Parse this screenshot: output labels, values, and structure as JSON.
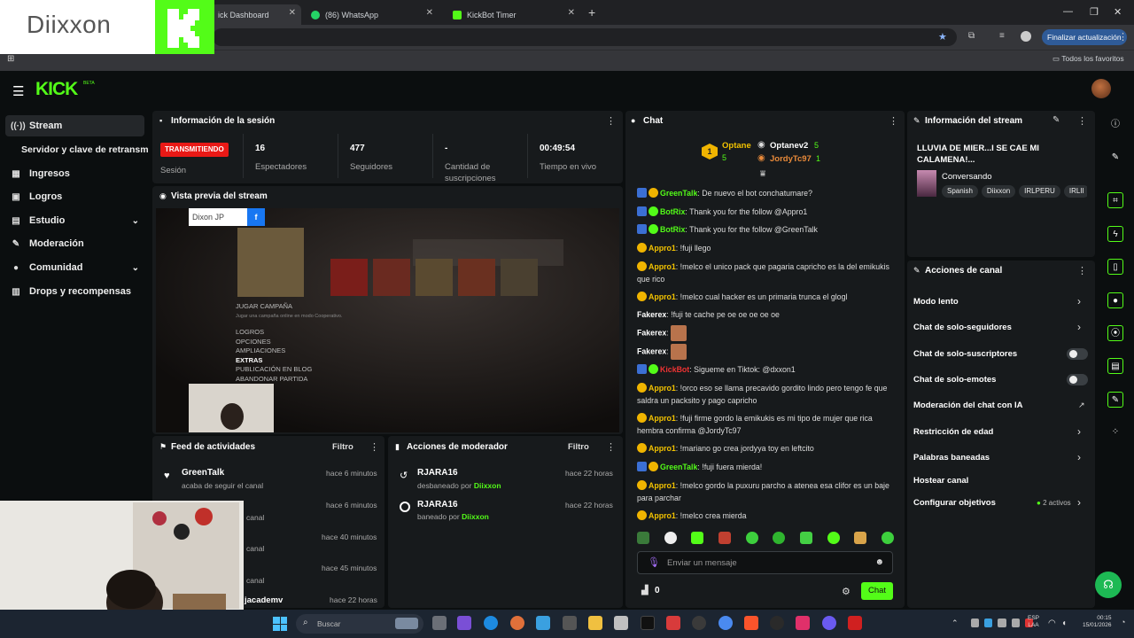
{
  "browser": {
    "tabs": [
      {
        "label": "ick Dashboard"
      },
      {
        "label": "(86) WhatsApp"
      },
      {
        "label": "KickBot Timer"
      }
    ],
    "update_button": "Finalizar actualización",
    "bookmarks_folder": "Todos los favoritos",
    "overlay_logo_text": "Diixxon"
  },
  "kick": {
    "logo": "KICK",
    "beta": "BETA"
  },
  "sidebar": {
    "items": [
      {
        "label": "Stream",
        "icon": "broadcast-icon"
      },
      {
        "label": "Servidor y clave de retransm"
      },
      {
        "label": "Ingresos",
        "icon": "money-icon"
      },
      {
        "label": "Logros",
        "icon": "trophy-icon"
      },
      {
        "label": "Estudio",
        "icon": "grid-icon"
      },
      {
        "label": "Moderación",
        "icon": "wrench-icon"
      },
      {
        "label": "Comunidad",
        "icon": "people-icon"
      },
      {
        "label": "Drops y recompensas",
        "icon": "gift-icon"
      }
    ]
  },
  "session": {
    "title": "Información de la sesión",
    "status": "TRANSMITIENDO",
    "status_label": "Sesión",
    "stats": [
      {
        "value": "16",
        "label": "Espectadores"
      },
      {
        "value": "477",
        "label": "Seguidores"
      },
      {
        "value": "-",
        "label": "Cantidad de suscripciones"
      },
      {
        "value": "00:49:54",
        "label": "Tiempo en vivo"
      }
    ]
  },
  "preview": {
    "title": "Vista previa del stream",
    "fb_tag": "Dixon JP",
    "menu_items": [
      "JUGAR CAMPAÑA",
      "Jugar una campaña online en modo Cooperativo.",
      "LOGROS",
      "OPCIONES",
      "AMPLIACIONES",
      "EXTRAS",
      "PUBLICACIÓN EN BLOG",
      "ABANDONAR PARTIDA"
    ]
  },
  "activity": {
    "title": "Feed de actividades",
    "filter": "Filtro",
    "items": [
      {
        "user": "GreenTalk",
        "desc": "acaba de seguir el canal",
        "time": "hace 6 minutos"
      },
      {
        "user": "",
        "desc": "canal",
        "time": "hace 6 minutos"
      },
      {
        "user": "",
        "desc": "canal",
        "time": "hace 40 minutos"
      },
      {
        "user": "",
        "desc": "canal",
        "time": "hace 45 minutos"
      },
      {
        "user": "",
        "desc": "canal",
        "time": ""
      },
      {
        "user": "",
        "desc": "jacademv",
        "time": "hace 22 horas"
      }
    ]
  },
  "modactions": {
    "title": "Acciones de moderador",
    "filter": "Filtro",
    "items": [
      {
        "user": "RJARA16",
        "action": "desbaneado por",
        "by": "Diixxon",
        "time": "hace 22 horas"
      },
      {
        "user": "RJARA16",
        "action": "baneado por",
        "by": "Diixxon",
        "time": "hace 22 horas"
      }
    ]
  },
  "chat": {
    "title": "Chat",
    "top_gifters": [
      {
        "name": "Optane",
        "count": "5"
      },
      {
        "name": "Optanev2",
        "count": "5"
      },
      {
        "name": "JordyTc97",
        "count": "1"
      }
    ],
    "messages": [
      {
        "user": "GreenTalk",
        "text": ": De nuevo el bot conchatumare?"
      },
      {
        "user": "BotRix",
        "text": ": Thank you for the follow @Appro1"
      },
      {
        "user": "BotRix",
        "text": ": Thank you for the follow @GreenTalk"
      },
      {
        "user": "Appro1",
        "text": ": !fuji llego"
      },
      {
        "user": "Appro1",
        "text": ": !melco el unico pack que pagaria capricho es la del emikukis que rico"
      },
      {
        "user": "Appro1",
        "text": ": !melco cual hacker es un primaria trunca el glogl"
      },
      {
        "user": "Fakerex",
        "text": ": !fuji te cache pe oe oe oe oe oe"
      },
      {
        "user": "Fakerex",
        "text": ":"
      },
      {
        "user": "Fakerex",
        "text": ":"
      },
      {
        "user": "KickBot",
        "text": ": Sigueme en Tiktok: @dxxon1"
      },
      {
        "user": "Appro1",
        "text": ": !orco eso se llama precavido gordito lindo pero tengo fe que saldra un packsito y pago capricho"
      },
      {
        "user": "Appro1",
        "text": ": !fuji firme gordo la emikukis es mi tipo de mujer que rica hembra confirma @JordyTc97"
      },
      {
        "user": "Appro1",
        "text": ": !mariano go crea jordyya toy en leftcito"
      },
      {
        "user": "GreenTalk",
        "text": ": !fuji fuera mierda!"
      },
      {
        "user": "Appro1",
        "text": ": !melco gordo la puxuru parcho a atenea esa clifor es un baje para parchar"
      },
      {
        "user": "Appro1",
        "text": ": !melco crea mierda"
      }
    ],
    "input_placeholder": "Enviar un mensaje",
    "points": "0",
    "send_label": "Chat"
  },
  "stream_info": {
    "title": "Información del stream",
    "stream_title": "LLUVIA DE MIER...I SE CAE MI CALAMENA!...",
    "category": "Conversando",
    "tags": [
      "Spanish",
      "Diixxon",
      "IRLPERU",
      "IRLII"
    ]
  },
  "channel_actions": {
    "title": "Acciones de canal",
    "items": [
      {
        "label": "Modo lento",
        "kind": "chevron"
      },
      {
        "label": "Chat de solo-seguidores",
        "kind": "chevron"
      },
      {
        "label": "Chat de solo-suscriptores",
        "kind": "toggle"
      },
      {
        "label": "Chat de solo-emotes",
        "kind": "toggle"
      },
      {
        "label": "Moderación del chat con IA",
        "kind": "external"
      },
      {
        "label": "Restricción de edad",
        "kind": "chevron"
      },
      {
        "label": "Palabras baneadas",
        "kind": "chevron"
      },
      {
        "label": "Hostear canal",
        "kind": "none"
      },
      {
        "label": "Configurar objetivos",
        "kind": "chevron",
        "badge": "2 activos"
      }
    ]
  },
  "taskbar": {
    "search_placeholder": "Buscar",
    "lang": "ESP",
    "lang2": "LAA",
    "time": "00:15",
    "date": "15/01/2026"
  },
  "colors": {
    "kick_green": "#53fc18",
    "live_red": "#e91916",
    "gold": "#f2c200"
  }
}
